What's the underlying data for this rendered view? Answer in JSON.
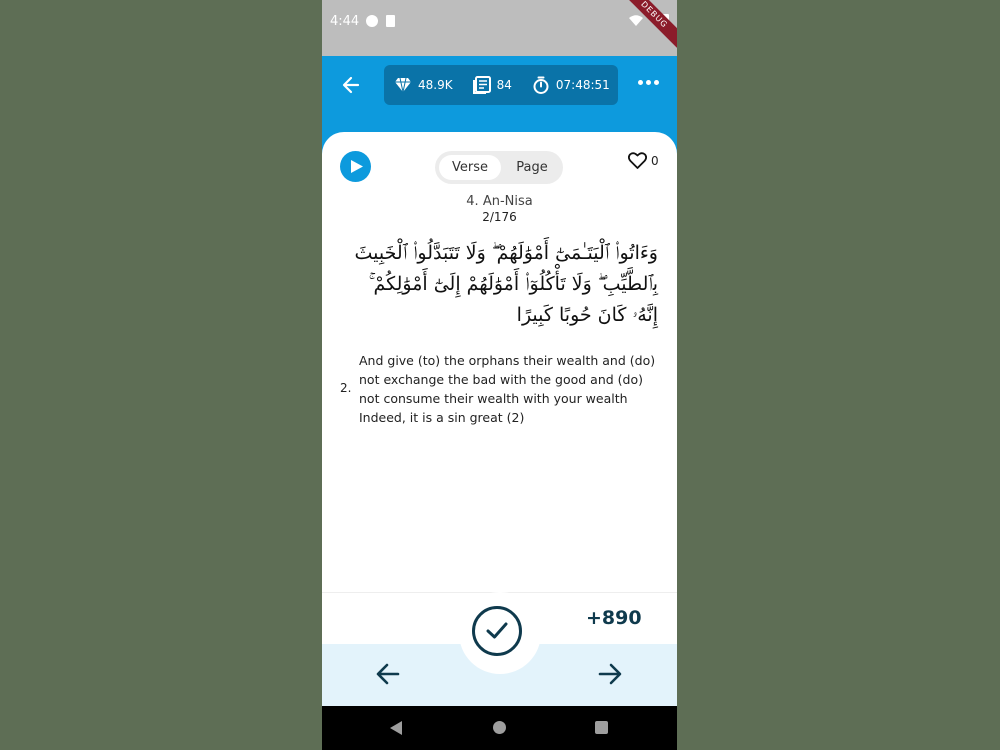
{
  "status_bar": {
    "time": "4:44",
    "debug_label": "DEBUG"
  },
  "stats": {
    "gems": "48.9K",
    "pages": "84",
    "timer": "07:48:51"
  },
  "view_toggle": {
    "verse": "Verse",
    "page": "Page",
    "selected": "Verse"
  },
  "favorite": {
    "count": "0"
  },
  "surah": {
    "name": "4. An-Nisa",
    "verse_position": "2/176"
  },
  "verse": {
    "arabic": "وَءَاتُوا۟ ٱلْيَتَـٰمَىٰٓ أَمْوَٰلَهُمْ ۖ وَلَا تَتَبَدَّلُوا۟ ٱلْخَبِيثَ بِٱلطَّيِّبِ ۖ وَلَا تَأْكُلُوٓا۟ أَمْوَٰلَهُمْ إِلَىٰٓ أَمْوَٰلِكُمْ ۚ إِنَّهُۥ كَانَ حُوبًا كَبِيرًا",
    "number": "2.",
    "translation": "And give (to) the orphans their wealth and (do) not exchange the bad with the good and (do) not consume their wealth with your wealth Indeed, it is a sin great (2)"
  },
  "reward": {
    "points": "+890"
  },
  "colors": {
    "primary": "#0d9add",
    "pill": "#0a73a8",
    "dark": "#0f3a4d",
    "bottom_bg": "#e3f3fb"
  },
  "icons": {
    "back": "arrow-left-icon",
    "gem": "diamond-icon",
    "pages": "book-icon",
    "timer": "stopwatch-icon",
    "more": "more-horizontal-icon",
    "play": "play-icon",
    "favorite": "heart-outline-icon",
    "complete": "check-icon",
    "prev": "arrow-left-icon",
    "next": "arrow-right-icon"
  }
}
